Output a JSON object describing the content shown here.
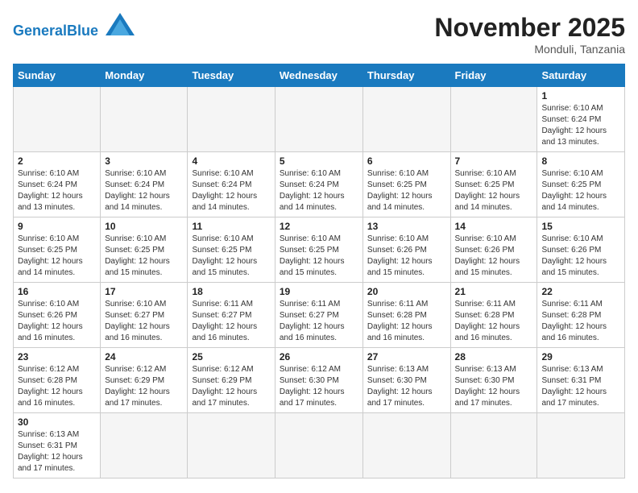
{
  "header": {
    "logo_general": "General",
    "logo_blue": "Blue",
    "month_year": "November 2025",
    "location": "Monduli, Tanzania"
  },
  "days_of_week": [
    "Sunday",
    "Monday",
    "Tuesday",
    "Wednesday",
    "Thursday",
    "Friday",
    "Saturday"
  ],
  "weeks": [
    [
      {
        "day": "",
        "info": ""
      },
      {
        "day": "",
        "info": ""
      },
      {
        "day": "",
        "info": ""
      },
      {
        "day": "",
        "info": ""
      },
      {
        "day": "",
        "info": ""
      },
      {
        "day": "",
        "info": ""
      },
      {
        "day": "1",
        "info": "Sunrise: 6:10 AM\nSunset: 6:24 PM\nDaylight: 12 hours and 13 minutes."
      }
    ],
    [
      {
        "day": "2",
        "info": "Sunrise: 6:10 AM\nSunset: 6:24 PM\nDaylight: 12 hours and 13 minutes."
      },
      {
        "day": "3",
        "info": "Sunrise: 6:10 AM\nSunset: 6:24 PM\nDaylight: 12 hours and 14 minutes."
      },
      {
        "day": "4",
        "info": "Sunrise: 6:10 AM\nSunset: 6:24 PM\nDaylight: 12 hours and 14 minutes."
      },
      {
        "day": "5",
        "info": "Sunrise: 6:10 AM\nSunset: 6:24 PM\nDaylight: 12 hours and 14 minutes."
      },
      {
        "day": "6",
        "info": "Sunrise: 6:10 AM\nSunset: 6:25 PM\nDaylight: 12 hours and 14 minutes."
      },
      {
        "day": "7",
        "info": "Sunrise: 6:10 AM\nSunset: 6:25 PM\nDaylight: 12 hours and 14 minutes."
      },
      {
        "day": "8",
        "info": "Sunrise: 6:10 AM\nSunset: 6:25 PM\nDaylight: 12 hours and 14 minutes."
      }
    ],
    [
      {
        "day": "9",
        "info": "Sunrise: 6:10 AM\nSunset: 6:25 PM\nDaylight: 12 hours and 14 minutes."
      },
      {
        "day": "10",
        "info": "Sunrise: 6:10 AM\nSunset: 6:25 PM\nDaylight: 12 hours and 15 minutes."
      },
      {
        "day": "11",
        "info": "Sunrise: 6:10 AM\nSunset: 6:25 PM\nDaylight: 12 hours and 15 minutes."
      },
      {
        "day": "12",
        "info": "Sunrise: 6:10 AM\nSunset: 6:25 PM\nDaylight: 12 hours and 15 minutes."
      },
      {
        "day": "13",
        "info": "Sunrise: 6:10 AM\nSunset: 6:26 PM\nDaylight: 12 hours and 15 minutes."
      },
      {
        "day": "14",
        "info": "Sunrise: 6:10 AM\nSunset: 6:26 PM\nDaylight: 12 hours and 15 minutes."
      },
      {
        "day": "15",
        "info": "Sunrise: 6:10 AM\nSunset: 6:26 PM\nDaylight: 12 hours and 15 minutes."
      }
    ],
    [
      {
        "day": "16",
        "info": "Sunrise: 6:10 AM\nSunset: 6:26 PM\nDaylight: 12 hours and 16 minutes."
      },
      {
        "day": "17",
        "info": "Sunrise: 6:10 AM\nSunset: 6:27 PM\nDaylight: 12 hours and 16 minutes."
      },
      {
        "day": "18",
        "info": "Sunrise: 6:11 AM\nSunset: 6:27 PM\nDaylight: 12 hours and 16 minutes."
      },
      {
        "day": "19",
        "info": "Sunrise: 6:11 AM\nSunset: 6:27 PM\nDaylight: 12 hours and 16 minutes."
      },
      {
        "day": "20",
        "info": "Sunrise: 6:11 AM\nSunset: 6:28 PM\nDaylight: 12 hours and 16 minutes."
      },
      {
        "day": "21",
        "info": "Sunrise: 6:11 AM\nSunset: 6:28 PM\nDaylight: 12 hours and 16 minutes."
      },
      {
        "day": "22",
        "info": "Sunrise: 6:11 AM\nSunset: 6:28 PM\nDaylight: 12 hours and 16 minutes."
      }
    ],
    [
      {
        "day": "23",
        "info": "Sunrise: 6:12 AM\nSunset: 6:28 PM\nDaylight: 12 hours and 16 minutes."
      },
      {
        "day": "24",
        "info": "Sunrise: 6:12 AM\nSunset: 6:29 PM\nDaylight: 12 hours and 17 minutes."
      },
      {
        "day": "25",
        "info": "Sunrise: 6:12 AM\nSunset: 6:29 PM\nDaylight: 12 hours and 17 minutes."
      },
      {
        "day": "26",
        "info": "Sunrise: 6:12 AM\nSunset: 6:30 PM\nDaylight: 12 hours and 17 minutes."
      },
      {
        "day": "27",
        "info": "Sunrise: 6:13 AM\nSunset: 6:30 PM\nDaylight: 12 hours and 17 minutes."
      },
      {
        "day": "28",
        "info": "Sunrise: 6:13 AM\nSunset: 6:30 PM\nDaylight: 12 hours and 17 minutes."
      },
      {
        "day": "29",
        "info": "Sunrise: 6:13 AM\nSunset: 6:31 PM\nDaylight: 12 hours and 17 minutes."
      }
    ],
    [
      {
        "day": "30",
        "info": "Sunrise: 6:13 AM\nSunset: 6:31 PM\nDaylight: 12 hours and 17 minutes."
      },
      {
        "day": "",
        "info": ""
      },
      {
        "day": "",
        "info": ""
      },
      {
        "day": "",
        "info": ""
      },
      {
        "day": "",
        "info": ""
      },
      {
        "day": "",
        "info": ""
      },
      {
        "day": "",
        "info": ""
      }
    ]
  ]
}
